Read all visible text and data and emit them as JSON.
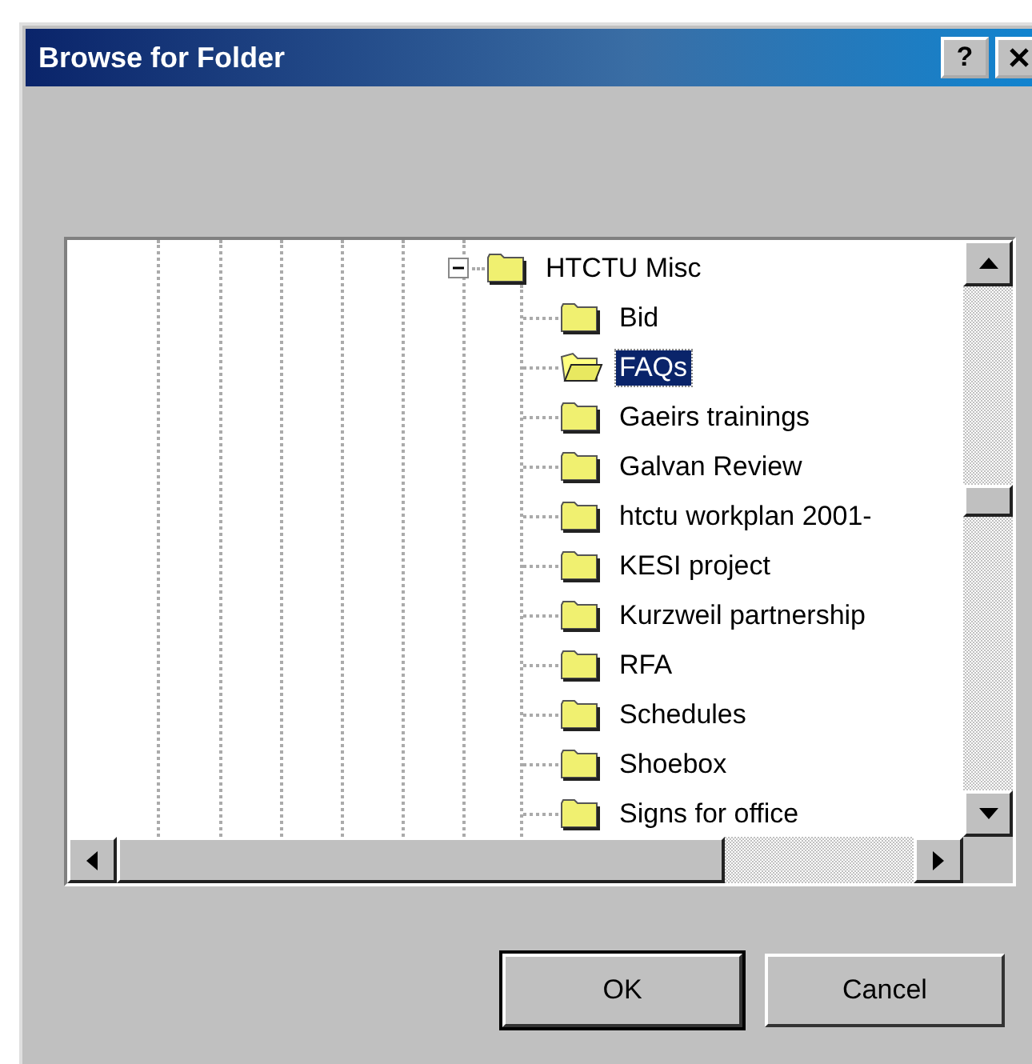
{
  "window": {
    "title": "Browse for Folder",
    "help_button": "?"
  },
  "tree": {
    "label": "HTCTU Misc",
    "expanded": true,
    "selected": false,
    "children": [
      {
        "label": "Bid",
        "selected": false
      },
      {
        "label": "FAQs",
        "selected": true
      },
      {
        "label": "Gaeirs trainings",
        "selected": false
      },
      {
        "label": "Galvan Review",
        "selected": false
      },
      {
        "label": "htctu workplan 2001-",
        "selected": false
      },
      {
        "label": "KESI project",
        "selected": false
      },
      {
        "label": "Kurzweil partnership",
        "selected": false
      },
      {
        "label": "RFA",
        "selected": false
      },
      {
        "label": "Schedules",
        "selected": false
      },
      {
        "label": "Shoebox",
        "selected": false
      },
      {
        "label": "Signs for office",
        "selected": false
      }
    ]
  },
  "buttons": [
    {
      "label": "OK",
      "default": true
    },
    {
      "label": "Cancel",
      "default": false
    }
  ]
}
